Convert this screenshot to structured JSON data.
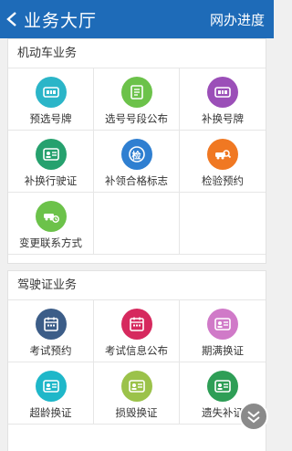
{
  "header": {
    "title": "业务大厅",
    "right_link": "网办进度",
    "back_icon": "chevron-left-icon",
    "background": "#1e6bb8"
  },
  "sections": [
    {
      "title": "机动车业务",
      "items": [
        {
          "label": "预选号牌",
          "icon": "plate-icon",
          "color": "#2bb5c8"
        },
        {
          "label": "选号号段公布",
          "icon": "notice-icon",
          "color": "#6cc24a"
        },
        {
          "label": "补换号牌",
          "icon": "plate-icon",
          "color": "#9b4fb8"
        },
        {
          "label": "补换行驶证",
          "icon": "license-icon",
          "color": "#26a16e"
        },
        {
          "label": "补领合格标志",
          "icon": "inspection-badge-icon",
          "color": "#2f7fd1",
          "badge_text": "检"
        },
        {
          "label": "检验预约",
          "icon": "car-search-icon",
          "color": "#f07822"
        },
        {
          "label": "变更联系方式",
          "icon": "car-phone-icon",
          "color": "#6cc24a"
        }
      ]
    },
    {
      "title": "驾驶证业务",
      "items": [
        {
          "label": "考试预约",
          "icon": "calendar-icon",
          "color": "#3c5d88"
        },
        {
          "label": "考试信息公布",
          "icon": "calendar-icon",
          "color": "#d6295e"
        },
        {
          "label": "期满换证",
          "icon": "license-icon",
          "color": "#d07ac8"
        },
        {
          "label": "超龄换证",
          "icon": "license-icon",
          "color": "#1fb7c9"
        },
        {
          "label": "损毁换证",
          "icon": "license-icon",
          "color": "#9bc24a"
        },
        {
          "label": "遗失补证",
          "icon": "license-icon",
          "color": "#2e9e56"
        }
      ]
    }
  ],
  "fab": {
    "icon": "double-chevron-down-icon"
  }
}
